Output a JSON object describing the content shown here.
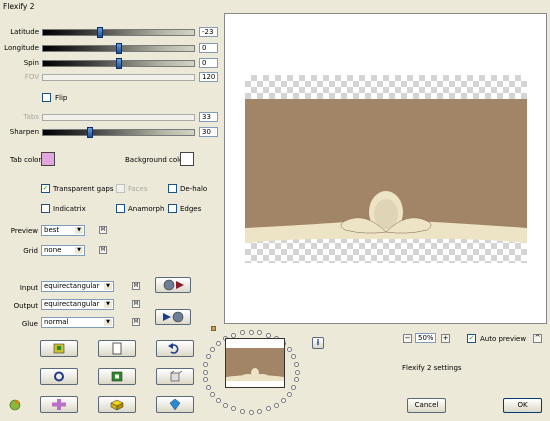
{
  "window": {
    "title": "Flexify 2"
  },
  "sliders": {
    "latitude": {
      "label": "Latitude",
      "value": "-23",
      "level": 0.37
    },
    "longitude": {
      "label": "Longitude",
      "value": "0",
      "level": 0.5
    },
    "spin": {
      "label": "Spin",
      "value": "0",
      "level": 0.5
    },
    "fov": {
      "label": "FOV",
      "value": "120"
    },
    "tabs": {
      "label": "Tabs",
      "value": "33"
    },
    "sharpen": {
      "label": "Sharpen",
      "value": "30",
      "level": 0.3
    }
  },
  "flip": {
    "label": "Flip",
    "checked": false
  },
  "colors": {
    "tab_label": "Tab color",
    "tab_color": "#e0a8dc",
    "background_label": "Background color",
    "background_color": "#ffffff",
    "accent": "#a28466",
    "cream": "#ede3c5"
  },
  "options": {
    "transparent_gaps": {
      "label": "Transparent gaps",
      "checked": true
    },
    "faces": {
      "label": "Faces",
      "enabled": false
    },
    "de_halo": {
      "label": "De-halo",
      "checked": false
    },
    "indicatrix": {
      "label": "Indicatrix",
      "checked": false
    },
    "anamorph": {
      "label": "Anamorph",
      "checked": false
    },
    "edges": {
      "label": "Edges",
      "checked": false
    }
  },
  "preview": {
    "label": "Preview",
    "value": "best",
    "mini": "M"
  },
  "grid": {
    "label": "Grid",
    "value": "none",
    "mini": "M"
  },
  "input": {
    "label": "Input",
    "value": "equirectangular",
    "mini": "M"
  },
  "output": {
    "label": "Output",
    "value": "equirectangular",
    "mini": "M"
  },
  "glue": {
    "label": "Glue",
    "value": "normal",
    "mini": "M"
  },
  "zoom": {
    "minus": "−",
    "value": "50%",
    "plus": "+"
  },
  "auto_preview": {
    "label": "Auto preview",
    "checked": true,
    "check": "✓",
    "collapse": "^"
  },
  "settings_text": "Flexify 2 settings",
  "info": "i",
  "buttons": {
    "cancel": "Cancel",
    "ok": "OK"
  }
}
